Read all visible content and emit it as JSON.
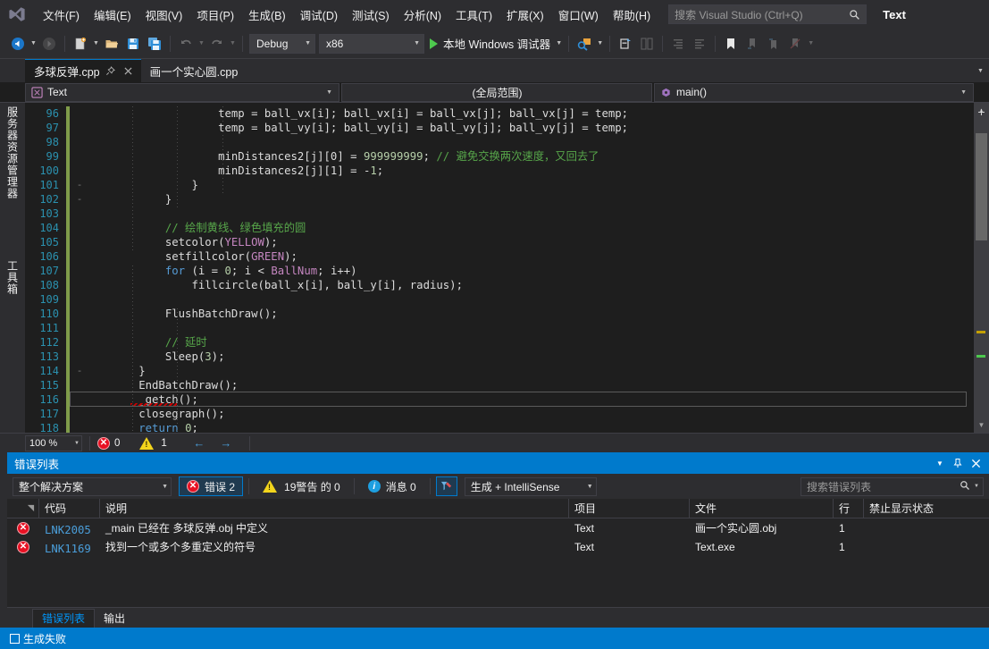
{
  "menubar": {
    "logo_icon": "visual-studio-logo-icon",
    "items": [
      {
        "label": "文件(F)"
      },
      {
        "label": "编辑(E)"
      },
      {
        "label": "视图(V)"
      },
      {
        "label": "项目(P)"
      },
      {
        "label": "生成(B)"
      },
      {
        "label": "调试(D)"
      },
      {
        "label": "测试(S)"
      },
      {
        "label": "分析(N)"
      },
      {
        "label": "工具(T)"
      },
      {
        "label": "扩展(X)"
      },
      {
        "label": "窗口(W)"
      },
      {
        "label": "帮助(H)"
      }
    ],
    "search_placeholder": "搜索 Visual Studio (Ctrl+Q)",
    "search_icon": "search-icon",
    "solution_title": "Text"
  },
  "toolbar": {
    "back_icon": "navigate-back-icon",
    "forward_icon": "navigate-forward-icon",
    "new_project_icon": "new-project-icon",
    "open_icon": "open-file-icon",
    "save_icon": "save-icon",
    "save_all_icon": "save-all-icon",
    "undo_icon": "undo-icon",
    "redo_icon": "redo-icon",
    "config_value": "Debug",
    "platform_value": "x86",
    "run_label": "本地 Windows 调试器",
    "run_icon": "play-icon",
    "process_icon": "attach-process-icon",
    "window_icon": "new-window-icon",
    "compare_icon": "compare-icon",
    "indent_icon": "increase-indent-icon",
    "outdent_icon": "decrease-indent-icon",
    "bookmark_icon": "bookmark-icon",
    "bm_next_icon": "next-bookmark-icon",
    "bm_prev_icon": "previous-bookmark-icon",
    "bm_clear_icon": "clear-bookmarks-icon",
    "overflow_icon": "toolbar-overflow-icon",
    "dropdown_icon": "chevron-down-icon"
  },
  "rail": {
    "top_label": "服务器资源管理器",
    "bottom_label": "工具箱"
  },
  "tabs": {
    "items": [
      {
        "label": "多球反弹.cpp",
        "active": true,
        "pin_icon": "pin-icon",
        "close_icon": "close-icon"
      },
      {
        "label": "画一个实心圆.cpp",
        "active": false
      }
    ],
    "overflow_icon": "tab-overflow-icon"
  },
  "navbar": {
    "project_icon": "cpp-project-icon",
    "project_value": "Text",
    "scope_value": "(全局范围)",
    "member_icon": "method-icon",
    "member_value": "main()",
    "dropdown_icon": "chevron-down-icon"
  },
  "editor": {
    "first_line_number": 96,
    "lines": [
      {
        "n": 96,
        "changed": true,
        "fold": "",
        "tokens": [
          {
            "t": "                    temp = ball_vx[i]; ball_vx[i] = ball_vx[j]; ball_vx[j] = temp;",
            "c": "idf"
          }
        ]
      },
      {
        "n": 97,
        "changed": true,
        "fold": "",
        "tokens": [
          {
            "t": "                    temp = ball_vy[i]; ball_vy[i] = ball_vy[j]; ball_vy[j] = temp;",
            "c": "idf"
          }
        ]
      },
      {
        "n": 98,
        "changed": true,
        "fold": "",
        "tokens": [
          {
            "t": "",
            "c": "idf"
          }
        ]
      },
      {
        "n": 99,
        "changed": true,
        "fold": "",
        "tokens": [
          {
            "t": "                    minDistances2[j][0] = ",
            "c": "idf"
          },
          {
            "t": "999999999",
            "c": "num"
          },
          {
            "t": "; ",
            "c": "idf"
          },
          {
            "t": "// 避免交换两次速度，又回去了",
            "c": "cmt"
          }
        ]
      },
      {
        "n": 100,
        "changed": true,
        "fold": "",
        "tokens": [
          {
            "t": "                    minDistances2[j][1] = -",
            "c": "idf"
          },
          {
            "t": "1",
            "c": "num"
          },
          {
            "t": ";",
            "c": "idf"
          }
        ]
      },
      {
        "n": 101,
        "changed": true,
        "fold": "-",
        "tokens": [
          {
            "t": "                }",
            "c": "idf"
          }
        ]
      },
      {
        "n": 102,
        "changed": true,
        "fold": "-",
        "tokens": [
          {
            "t": "            }",
            "c": "idf"
          }
        ]
      },
      {
        "n": 103,
        "changed": true,
        "fold": "",
        "tokens": [
          {
            "t": "",
            "c": "idf"
          }
        ]
      },
      {
        "n": 104,
        "changed": true,
        "fold": "",
        "tokens": [
          {
            "t": "            ",
            "c": "idf"
          },
          {
            "t": "// 绘制黄线、绿色填充的圆",
            "c": "cmt"
          }
        ]
      },
      {
        "n": 105,
        "changed": true,
        "fold": "",
        "tokens": [
          {
            "t": "            setcolor(",
            "c": "idf"
          },
          {
            "t": "YELLOW",
            "c": "mac"
          },
          {
            "t": ");",
            "c": "idf"
          }
        ]
      },
      {
        "n": 106,
        "changed": true,
        "fold": "",
        "tokens": [
          {
            "t": "            setfillcolor(",
            "c": "idf"
          },
          {
            "t": "GREEN",
            "c": "mac"
          },
          {
            "t": ");",
            "c": "idf"
          }
        ]
      },
      {
        "n": 107,
        "changed": true,
        "fold": "",
        "tokens": [
          {
            "t": "            ",
            "c": "idf"
          },
          {
            "t": "for",
            "c": "kw"
          },
          {
            "t": " (i = ",
            "c": "idf"
          },
          {
            "t": "0",
            "c": "num"
          },
          {
            "t": "; i < ",
            "c": "idf"
          },
          {
            "t": "BallNum",
            "c": "mac"
          },
          {
            "t": "; i++)",
            "c": "idf"
          }
        ]
      },
      {
        "n": 108,
        "changed": true,
        "fold": "",
        "tokens": [
          {
            "t": "                fillcircle(ball_x[i], ball_y[i], radius);",
            "c": "idf"
          }
        ]
      },
      {
        "n": 109,
        "changed": true,
        "fold": "",
        "tokens": [
          {
            "t": "",
            "c": "idf"
          }
        ]
      },
      {
        "n": 110,
        "changed": true,
        "fold": "",
        "tokens": [
          {
            "t": "            FlushBatchDraw();",
            "c": "idf"
          }
        ]
      },
      {
        "n": 111,
        "changed": true,
        "fold": "",
        "tokens": [
          {
            "t": "",
            "c": "idf"
          }
        ]
      },
      {
        "n": 112,
        "changed": true,
        "fold": "",
        "tokens": [
          {
            "t": "            ",
            "c": "idf"
          },
          {
            "t": "// 延时",
            "c": "cmt"
          }
        ]
      },
      {
        "n": 113,
        "changed": true,
        "fold": "",
        "tokens": [
          {
            "t": "            Sleep(",
            "c": "idf"
          },
          {
            "t": "3",
            "c": "num"
          },
          {
            "t": ");",
            "c": "idf"
          }
        ]
      },
      {
        "n": 114,
        "changed": true,
        "fold": "-",
        "tokens": [
          {
            "t": "        }",
            "c": "idf"
          }
        ]
      },
      {
        "n": 115,
        "changed": true,
        "fold": "",
        "tokens": [
          {
            "t": "        EndBatchDraw();",
            "c": "idf"
          }
        ]
      },
      {
        "n": 116,
        "changed": true,
        "fold": "",
        "tokens": [
          {
            "t": "        _getch();",
            "c": "idf"
          }
        ]
      },
      {
        "n": 117,
        "changed": true,
        "fold": "",
        "tokens": [
          {
            "t": "        closegraph();",
            "c": "idf"
          }
        ]
      },
      {
        "n": 118,
        "changed": true,
        "fold": "",
        "tokens": [
          {
            "t": "        ",
            "c": "idf"
          },
          {
            "t": "return",
            "c": "kw"
          },
          {
            "t": " ",
            "c": "idf"
          },
          {
            "t": "0",
            "c": "num"
          },
          {
            "t": ";",
            "c": "idf"
          }
        ]
      }
    ],
    "current_line": 116,
    "scroll_up_icon": "scroll-up-icon",
    "scroll_down_icon": "scroll-down-icon",
    "add_split_icon": "split-view-icon"
  },
  "editor_status": {
    "zoom_value": "100 %",
    "zoom_dropdown_icon": "chevron-down-icon",
    "error_icon": "error-icon",
    "error_count": "0",
    "warning_icon": "warning-icon",
    "warning_count": "1",
    "prev_icon": "previous-issue-icon",
    "next_icon": "next-issue-icon"
  },
  "error_panel": {
    "title": "错误列表",
    "dropdown_icon": "chevron-down-icon",
    "pin_icon": "pin-icon",
    "close_icon": "close-icon",
    "scope_value": "整个解决方案",
    "errors_label": "错误 2",
    "warnings_label": "19警告 的 0",
    "messages_label": "消息 0",
    "filter_icon": "build-filter-icon",
    "build_value": "生成 + IntelliSense",
    "search_placeholder": "搜索错误列表",
    "search_icon": "search-icon",
    "search_dropdown_icon": "chevron-down-icon",
    "columns": [
      {
        "label": ""
      },
      {
        "label": "代码"
      },
      {
        "label": "说明"
      },
      {
        "label": "项目"
      },
      {
        "label": "文件"
      },
      {
        "label": "行"
      },
      {
        "label": "禁止显示状态"
      }
    ],
    "rows": [
      {
        "severity_icon": "error-icon",
        "code": "LNK2005",
        "description": "_main 已经在 多球反弹.obj 中定义",
        "project": "Text",
        "file": "画一个实心圆.obj",
        "line": "1",
        "suppression": ""
      },
      {
        "severity_icon": "error-icon",
        "code": "LNK1169",
        "description": "找到一个或多个多重定义的符号",
        "project": "Text",
        "file": "Text.exe",
        "line": "1",
        "suppression": ""
      }
    ],
    "bottom_tabs": [
      {
        "label": "错误列表",
        "active": true
      },
      {
        "label": "输出",
        "active": false
      }
    ]
  },
  "statusbar": {
    "status_icon": "build-status-icon",
    "status_text": "生成失败"
  }
}
